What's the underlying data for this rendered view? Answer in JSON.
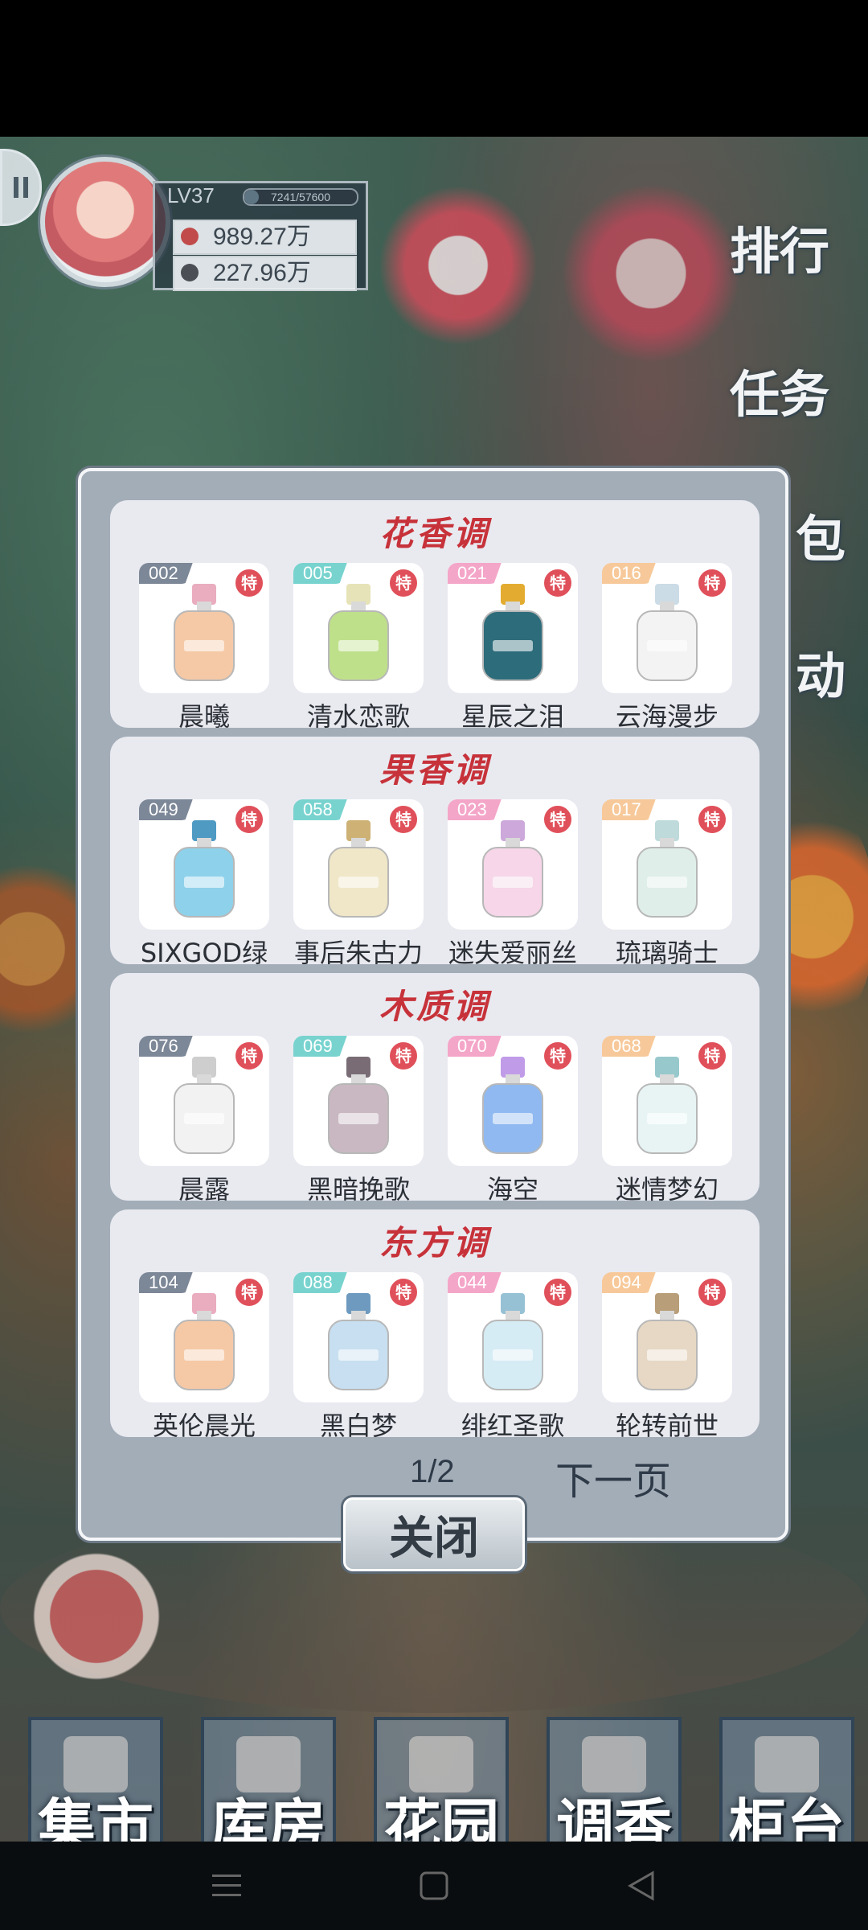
{
  "player": {
    "level": "LV37",
    "exp_text": "7241/57600",
    "exp_fraction": 0.126,
    "currency_red": "989.27万",
    "currency_dark": "227.96万"
  },
  "side_menu": [
    "排行",
    "任务",
    "包",
    "动"
  ],
  "modal": {
    "sections": [
      {
        "title": "花香调",
        "items": [
          {
            "no": "002",
            "name": "晨曦",
            "badge": "特"
          },
          {
            "no": "005",
            "name": "清水恋歌",
            "badge": "特"
          },
          {
            "no": "021",
            "name": "星辰之泪",
            "badge": "特"
          },
          {
            "no": "016",
            "name": "云海漫步",
            "badge": "特"
          }
        ]
      },
      {
        "title": "果香调",
        "items": [
          {
            "no": "049",
            "name": "SIXGOD绿",
            "badge": "特"
          },
          {
            "no": "058",
            "name": "事后朱古力",
            "badge": "特"
          },
          {
            "no": "023",
            "name": "迷失爱丽丝",
            "badge": "特"
          },
          {
            "no": "017",
            "name": "琉璃骑士",
            "badge": "特"
          }
        ]
      },
      {
        "title": "木质调",
        "items": [
          {
            "no": "076",
            "name": "晨露",
            "badge": "特"
          },
          {
            "no": "069",
            "name": "黑暗挽歌",
            "badge": "特"
          },
          {
            "no": "070",
            "name": "海空",
            "badge": "特"
          },
          {
            "no": "068",
            "name": "迷情梦幻",
            "badge": "特"
          }
        ]
      },
      {
        "title": "东方调",
        "items": [
          {
            "no": "104",
            "name": "英伦晨光",
            "badge": "特"
          },
          {
            "no": "088",
            "name": "黑白梦",
            "badge": "特"
          },
          {
            "no": "044",
            "name": "绯红圣歌",
            "badge": "特"
          },
          {
            "no": "094",
            "name": "轮转前世",
            "badge": "特"
          }
        ]
      }
    ],
    "page_indicator": "1/2",
    "next_page": "下一页",
    "close": "关闭"
  },
  "bottom_nav": [
    "集市",
    "库房",
    "花园",
    "调香",
    "柜台"
  ],
  "colors": {
    "section_title": "#c7323a",
    "badge": "#e0505a",
    "number_tags": [
      "#7c8797",
      "#78d3cf",
      "#f4a6c9",
      "#f7c99a"
    ]
  }
}
